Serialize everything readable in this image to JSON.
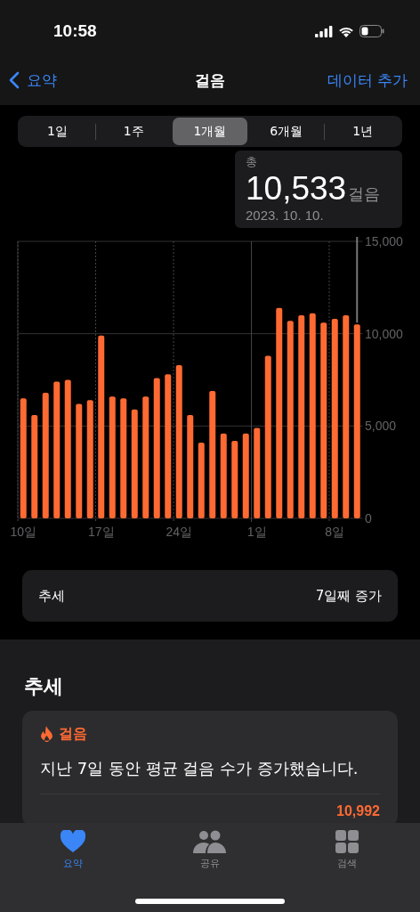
{
  "status_bar": {
    "time": "10:58"
  },
  "nav": {
    "back": "요약",
    "title": "걸음",
    "action": "데이터 추가"
  },
  "segments": [
    {
      "label": "1일",
      "selected": false
    },
    {
      "label": "1주",
      "selected": false
    },
    {
      "label": "1개월",
      "selected": true
    },
    {
      "label": "6개월",
      "selected": false
    },
    {
      "label": "1년",
      "selected": false
    }
  ],
  "callout": {
    "label": "총",
    "value": "10,533",
    "unit": "걸음",
    "date": "2023. 10. 10."
  },
  "chart": {
    "chart_data": {
      "type": "bar",
      "categories": [
        "10일",
        null,
        null,
        null,
        null,
        null,
        null,
        "17일",
        null,
        null,
        null,
        null,
        null,
        null,
        "24일",
        null,
        null,
        null,
        null,
        null,
        null,
        "1일",
        null,
        null,
        null,
        null,
        null,
        null,
        "8일",
        null,
        null
      ],
      "series": [
        {
          "color": "#ff6a33",
          "values": [
            6500,
            5600,
            6800,
            7400,
            7500,
            6200,
            6400,
            9900,
            6600,
            6500,
            5900,
            6600,
            7600,
            7800,
            8300,
            5600,
            4100,
            6900,
            4600,
            4200,
            4600,
            4900,
            8800,
            11400,
            10700,
            11000,
            11100,
            10600,
            10800,
            11000,
            10500
          ]
        }
      ],
      "ylim": [
        0,
        15000
      ],
      "grid": true,
      "yticks": [
        {
          "value": 0,
          "label": "0"
        },
        {
          "value": 5000,
          "label": "5,000"
        },
        {
          "value": 10000,
          "label": "10,000"
        },
        {
          "value": 15000,
          "label": "15,000"
        }
      ]
    }
  },
  "trend_row": {
    "label": "추세",
    "value": "7일째 증가"
  },
  "trends_section": {
    "heading": "추세",
    "card": {
      "category": "걸음",
      "text": "지난 7일 동안 평균 걸음 수가 증가했습니다.",
      "value": "10,992"
    }
  },
  "tab_bar": [
    {
      "label": "요약",
      "selected": true
    },
    {
      "label": "공유",
      "selected": false
    },
    {
      "label": "검색",
      "selected": false
    }
  ]
}
